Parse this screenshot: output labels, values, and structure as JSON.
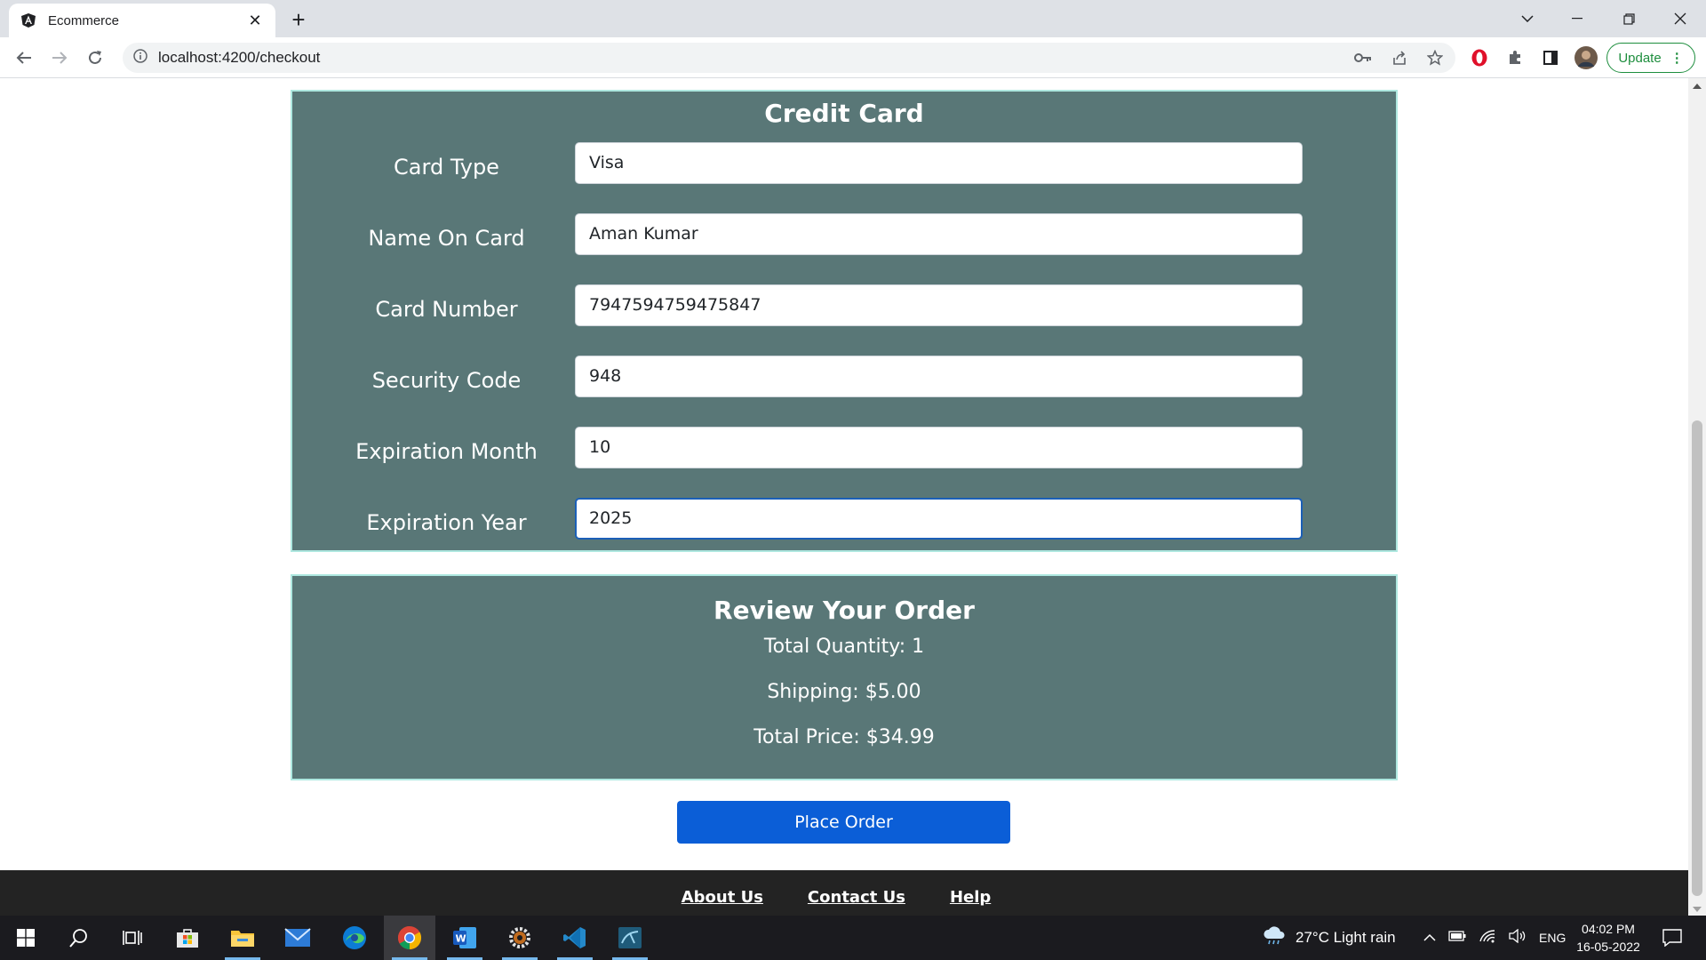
{
  "browser": {
    "tab_title": "Ecommerce",
    "url": "localhost:4200/checkout",
    "update_label": "Update",
    "update_menu": "⋮"
  },
  "credit_card": {
    "title": "Credit Card",
    "fields": [
      {
        "label": "Card Type",
        "value": "Visa"
      },
      {
        "label": "Name On Card",
        "value": "Aman Kumar"
      },
      {
        "label": "Card Number",
        "value": "7947594759475847"
      },
      {
        "label": "Security Code",
        "value": "948"
      },
      {
        "label": "Expiration Month",
        "value": "10"
      },
      {
        "label": "Expiration Year",
        "value": "2025"
      }
    ]
  },
  "review": {
    "title": "Review Your Order",
    "total_quantity": "Total Quantity: 1",
    "shipping": "Shipping: $5.00",
    "total_price": "Total Price: $34.99"
  },
  "place_order_label": "Place Order",
  "footer": {
    "links": [
      "About Us",
      "Contact Us",
      "Help"
    ]
  },
  "taskbar": {
    "weather": "27°C  Light rain",
    "language": "ENG",
    "time": "04:02 PM",
    "date": "16-05-2022"
  },
  "colors": {
    "panel": "#597777",
    "panel_border": "#aee8e0",
    "primary": "#0b5ed7",
    "footer": "#232323"
  }
}
